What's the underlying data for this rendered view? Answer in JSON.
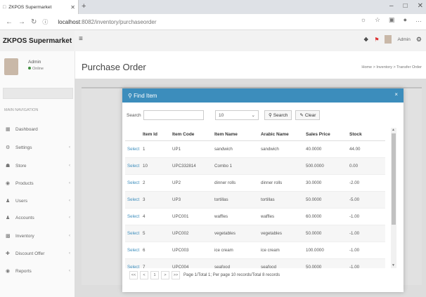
{
  "browser": {
    "tab_title": "ZKPOS Supermarket",
    "url_host": "localhost",
    "url_rest": ":8082/inventory/purchaseorder"
  },
  "app": {
    "logo": "ZKPOS Supermarket",
    "user": "Admin",
    "status": "Online",
    "header_user": "Admin"
  },
  "sidebar": {
    "section": "MAIN NAVIGATION",
    "items": [
      {
        "label": "Dashboard",
        "icon": "dashboard-icon"
      },
      {
        "label": "Settings",
        "icon": "gear-icon"
      },
      {
        "label": "Store",
        "icon": "store-icon"
      },
      {
        "label": "Products",
        "icon": "products-icon"
      },
      {
        "label": "Users",
        "icon": "users-icon"
      },
      {
        "label": "Accounts",
        "icon": "accounts-icon"
      },
      {
        "label": "Inventory",
        "icon": "inventory-icon"
      },
      {
        "label": "Discount Offer",
        "icon": "discount-icon"
      },
      {
        "label": "Reports",
        "icon": "reports-icon"
      }
    ]
  },
  "page": {
    "title": "Purchase Order",
    "breadcrumb": "Home > Inventory > Transfer Order"
  },
  "modal": {
    "title": "Find Item",
    "search_label": "Search",
    "page_size": "10",
    "search_button": "Search",
    "clear_button": "Clear",
    "columns": [
      "",
      "Item Id",
      "Item Code",
      "Item Name",
      "Arabic Name",
      "Sales Price",
      "Stock"
    ],
    "rows": [
      {
        "action": "Select",
        "id": "1",
        "code": "UP1",
        "name": "sandwich",
        "arabic": "sandwich",
        "price": "40.0000",
        "stock": "44.00"
      },
      {
        "action": "Select",
        "id": "10",
        "code": "UPC332814",
        "name": "Combo 1",
        "arabic": "",
        "price": "500.0000",
        "stock": "0.00"
      },
      {
        "action": "Select",
        "id": "2",
        "code": "UP2",
        "name": "dinner rolls",
        "arabic": "dinner rolls",
        "price": "30.0000",
        "stock": "-2.00"
      },
      {
        "action": "Select",
        "id": "3",
        "code": "UP3",
        "name": "tortillas",
        "arabic": "tortillas",
        "price": "50.0000",
        "stock": "-5.00"
      },
      {
        "action": "Select",
        "id": "4",
        "code": "UPC001",
        "name": "waffles",
        "arabic": "waffles",
        "price": "60.0000",
        "stock": "-1.00"
      },
      {
        "action": "Select",
        "id": "5",
        "code": "UPC002",
        "name": "vegetables",
        "arabic": "vegetables",
        "price": "50.0000",
        "stock": "-1.00"
      },
      {
        "action": "Select",
        "id": "6",
        "code": "UPC003",
        "name": "ice cream",
        "arabic": "ice cream",
        "price": "100.0000",
        "stock": "-1.00"
      },
      {
        "action": "Select",
        "id": "7",
        "code": "UPC004",
        "name": "seafood",
        "arabic": "seafood",
        "price": "50.0000",
        "stock": "-1.00"
      }
    ],
    "pager": {
      "first": "<<",
      "prev": "<",
      "page": "1",
      "next": ">",
      "last": ">>",
      "info": "Page 1/Total 1; Per page 10 records/Total 8 records"
    }
  },
  "colors": {
    "accent": "#3c8dbc"
  }
}
